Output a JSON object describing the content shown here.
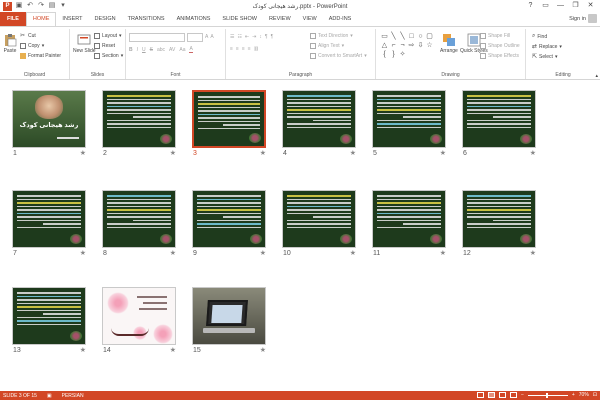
{
  "window": {
    "title": "رشد هیجانی کودک.pptx - PowerPoint",
    "app_icon": "P",
    "controls": [
      "?",
      "▭",
      "—",
      "❐",
      "✕"
    ]
  },
  "tabs": [
    {
      "label": "FILE",
      "kind": "file"
    },
    {
      "label": "HOME",
      "kind": "active"
    },
    {
      "label": "INSERT"
    },
    {
      "label": "DESIGN"
    },
    {
      "label": "TRANSITIONS"
    },
    {
      "label": "ANIMATIONS"
    },
    {
      "label": "SLIDE SHOW"
    },
    {
      "label": "REVIEW"
    },
    {
      "label": "VIEW"
    },
    {
      "label": "ADD-INS"
    }
  ],
  "signin": "Sign in",
  "ribbon": {
    "clipboard": {
      "label": "Clipboard",
      "paste": "Paste",
      "cut": "Cut",
      "copy": "Copy",
      "format_painter": "Format Painter"
    },
    "slides": {
      "label": "Slides",
      "new_slide": "New Slide",
      "layout": "Layout",
      "reset": "Reset",
      "section": "Section"
    },
    "font": {
      "label": "Font",
      "bold": "B",
      "italic": "I",
      "underline": "U",
      "strike": "S",
      "abc": "abc",
      "av": "AV",
      "aa": "Aa",
      "clear": "A"
    },
    "paragraph": {
      "label": "Paragraph",
      "text_direction": "Text Direction",
      "align_text": "Align Text",
      "convert_smartart": "Convert to SmartArt"
    },
    "drawing": {
      "label": "Drawing",
      "arrange": "Arrange",
      "quick_styles": "Quick Styles",
      "shape_fill": "Shape Fill",
      "shape_outline": "Shape Outline",
      "shape_effects": "Shape Effects"
    },
    "editing": {
      "label": "Editing",
      "find": "Find",
      "replace": "Replace",
      "select": "Select"
    }
  },
  "slides": [
    {
      "num": "1",
      "kind": "title",
      "title": "رشد هیجانی کودک"
    },
    {
      "num": "2",
      "kind": "text"
    },
    {
      "num": "3",
      "kind": "text",
      "selected": true
    },
    {
      "num": "4",
      "kind": "text"
    },
    {
      "num": "5",
      "kind": "text"
    },
    {
      "num": "6",
      "kind": "text"
    },
    {
      "num": "7",
      "kind": "text"
    },
    {
      "num": "8",
      "kind": "text"
    },
    {
      "num": "9",
      "kind": "text"
    },
    {
      "num": "10",
      "kind": "text"
    },
    {
      "num": "11",
      "kind": "text"
    },
    {
      "num": "12",
      "kind": "text"
    },
    {
      "num": "13",
      "kind": "text"
    },
    {
      "num": "14",
      "kind": "card"
    },
    {
      "num": "15",
      "kind": "laptop"
    }
  ],
  "status": {
    "slide_info": "SLIDE 3 OF 15",
    "language": "PERSIAN",
    "zoom": "70%"
  },
  "colors": {
    "accent": "#d24726"
  }
}
